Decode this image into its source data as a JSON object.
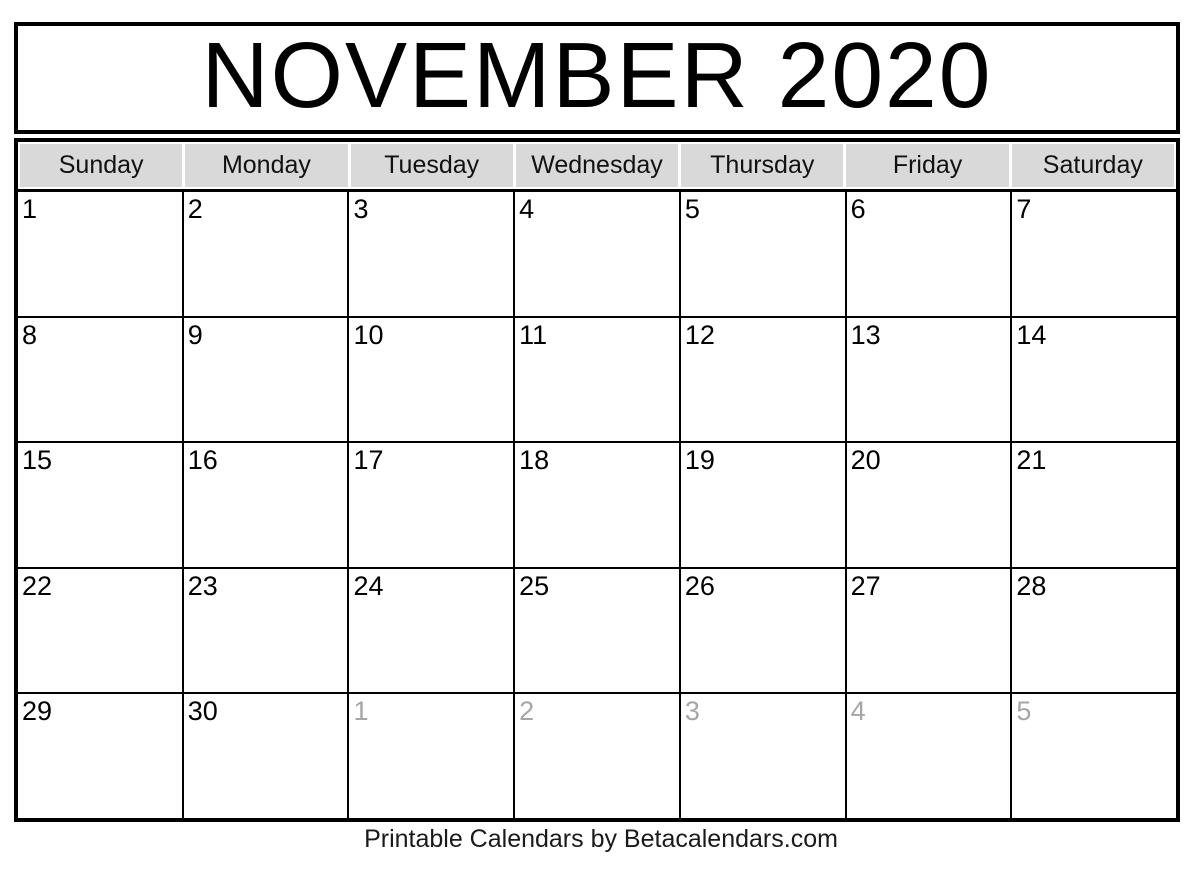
{
  "calendar": {
    "title": "NOVEMBER 2020",
    "month_name": "November",
    "year": "2020",
    "weekday_headers": [
      {
        "label": "Sunday"
      },
      {
        "label": "Monday"
      },
      {
        "label": "Tuesday"
      },
      {
        "label": "Wednesday"
      },
      {
        "label": "Thursday"
      },
      {
        "label": "Friday"
      },
      {
        "label": "Saturday"
      }
    ],
    "weeks": [
      {
        "days": [
          {
            "number": "1",
            "other_month": false
          },
          {
            "number": "2",
            "other_month": false
          },
          {
            "number": "3",
            "other_month": false
          },
          {
            "number": "4",
            "other_month": false
          },
          {
            "number": "5",
            "other_month": false
          },
          {
            "number": "6",
            "other_month": false
          },
          {
            "number": "7",
            "other_month": false
          }
        ]
      },
      {
        "days": [
          {
            "number": "8",
            "other_month": false
          },
          {
            "number": "9",
            "other_month": false
          },
          {
            "number": "10",
            "other_month": false
          },
          {
            "number": "11",
            "other_month": false
          },
          {
            "number": "12",
            "other_month": false
          },
          {
            "number": "13",
            "other_month": false
          },
          {
            "number": "14",
            "other_month": false
          }
        ]
      },
      {
        "days": [
          {
            "number": "15",
            "other_month": false
          },
          {
            "number": "16",
            "other_month": false
          },
          {
            "number": "17",
            "other_month": false
          },
          {
            "number": "18",
            "other_month": false
          },
          {
            "number": "19",
            "other_month": false
          },
          {
            "number": "20",
            "other_month": false
          },
          {
            "number": "21",
            "other_month": false
          }
        ]
      },
      {
        "days": [
          {
            "number": "22",
            "other_month": false
          },
          {
            "number": "23",
            "other_month": false
          },
          {
            "number": "24",
            "other_month": false
          },
          {
            "number": "25",
            "other_month": false
          },
          {
            "number": "26",
            "other_month": false
          },
          {
            "number": "27",
            "other_month": false
          },
          {
            "number": "28",
            "other_month": false
          }
        ]
      },
      {
        "days": [
          {
            "number": "29",
            "other_month": false
          },
          {
            "number": "30",
            "other_month": false
          },
          {
            "number": "1",
            "other_month": true
          },
          {
            "number": "2",
            "other_month": true
          },
          {
            "number": "3",
            "other_month": true
          },
          {
            "number": "4",
            "other_month": true
          },
          {
            "number": "5",
            "other_month": true
          }
        ]
      }
    ]
  },
  "footer": {
    "credit": "Printable Calendars by Betacalendars.com"
  },
  "colors": {
    "header_background": "#d9d9d9",
    "border": "#000000",
    "current_month_text": "#000000",
    "other_month_text": "#a6a6a6",
    "page_background": "#ffffff"
  }
}
